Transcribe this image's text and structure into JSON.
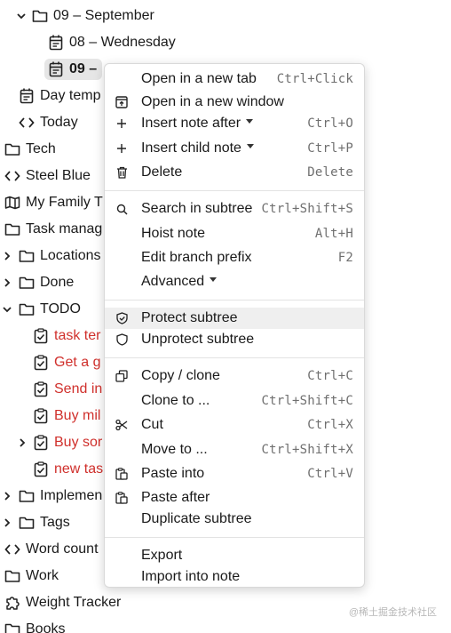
{
  "tree": [
    {
      "id": "sep",
      "label": "09 – September"
    },
    {
      "id": "wed",
      "label": "08 – Wednesday"
    },
    {
      "id": "cur",
      "label": "09 – "
    },
    {
      "id": "day",
      "label": "Day temp"
    },
    {
      "id": "today",
      "label": "Today"
    },
    {
      "id": "tech",
      "label": "Tech"
    },
    {
      "id": "steel",
      "label": "Steel Blue"
    },
    {
      "id": "family",
      "label": "My Family T"
    },
    {
      "id": "taskman",
      "label": "Task manag"
    },
    {
      "id": "locations",
      "label": "Locations"
    },
    {
      "id": "done",
      "label": "Done"
    },
    {
      "id": "todo",
      "label": "TODO"
    },
    {
      "id": "t1",
      "label": "task ter"
    },
    {
      "id": "t2",
      "label": "Get a g"
    },
    {
      "id": "t3",
      "label": "Send in"
    },
    {
      "id": "t4",
      "label": "Buy mil"
    },
    {
      "id": "t5",
      "label": "Buy sor"
    },
    {
      "id": "t6",
      "label": "new tas"
    },
    {
      "id": "impl",
      "label": "Implemen"
    },
    {
      "id": "tags",
      "label": "Tags"
    },
    {
      "id": "wordcount",
      "label": "Word count"
    },
    {
      "id": "work",
      "label": "Work"
    },
    {
      "id": "weight",
      "label": "Weight Tracker"
    },
    {
      "id": "books",
      "label": "Books"
    }
  ],
  "menu": {
    "items": [
      {
        "label": "Open in a new tab",
        "shortcut": "Ctrl+Click",
        "icon": "none"
      },
      {
        "label": "Open in a new window",
        "shortcut": "",
        "icon": "open-window-icon"
      },
      {
        "label": "Insert note after",
        "shortcut": "Ctrl+O",
        "icon": "plus-icon"
      },
      {
        "label": "Insert child note",
        "shortcut": "Ctrl+P",
        "icon": "plus-icon"
      },
      {
        "label": "Delete",
        "shortcut": "Delete",
        "icon": "trash-icon"
      },
      {
        "label": "Search in subtree",
        "shortcut": "Ctrl+Shift+S",
        "icon": "search-icon"
      },
      {
        "label": "Hoist note",
        "shortcut": "Alt+H",
        "icon": "none"
      },
      {
        "label": "Edit branch prefix",
        "shortcut": "F2",
        "icon": "none"
      },
      {
        "label": "Advanced",
        "shortcut": "",
        "icon": "none"
      },
      {
        "label": "Protect subtree",
        "shortcut": "",
        "icon": "shield-check-icon"
      },
      {
        "label": "Unprotect subtree",
        "shortcut": "",
        "icon": "shield-icon"
      },
      {
        "label": "Copy / clone",
        "shortcut": "Ctrl+C",
        "icon": "copy-icon"
      },
      {
        "label": "Clone to ...",
        "shortcut": "Ctrl+Shift+C",
        "icon": "none"
      },
      {
        "label": "Cut",
        "shortcut": "Ctrl+X",
        "icon": "scissors-icon"
      },
      {
        "label": "Move to ...",
        "shortcut": "Ctrl+Shift+X",
        "icon": "none"
      },
      {
        "label": "Paste into",
        "shortcut": "Ctrl+V",
        "icon": "paste-icon"
      },
      {
        "label": "Paste after",
        "shortcut": "",
        "icon": "paste-icon"
      },
      {
        "label": "Duplicate subtree",
        "shortcut": "",
        "icon": "none"
      },
      {
        "label": "Export",
        "shortcut": "",
        "icon": "none"
      },
      {
        "label": "Import into note",
        "shortcut": "",
        "icon": "none"
      }
    ]
  },
  "watermark": "@稀土掘金技术社区",
  "colors": {
    "task_red": "#d0302c",
    "highlight": "#efefef",
    "menu_border": "#d9d9d9"
  }
}
